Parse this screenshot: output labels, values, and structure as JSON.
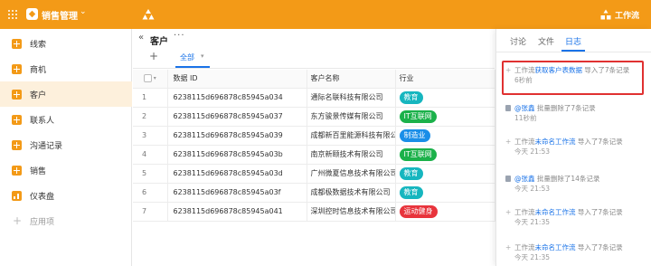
{
  "topbar": {
    "app_title": "销售管理",
    "caret": "⌄",
    "workflow_label": "工作流",
    "bg_color": "#f39a17"
  },
  "sidebar": {
    "items": [
      {
        "label": "线索",
        "icon": "plus-square-icon",
        "active": false
      },
      {
        "label": "商机",
        "icon": "plus-square-icon",
        "active": false
      },
      {
        "label": "客户",
        "icon": "plus-square-icon",
        "active": true
      },
      {
        "label": "联系人",
        "icon": "plus-square-icon",
        "active": false
      },
      {
        "label": "沟通记录",
        "icon": "plus-square-icon",
        "active": false
      },
      {
        "label": "销售",
        "icon": "plus-square-icon",
        "active": false
      },
      {
        "label": "仪表盘",
        "icon": "dashboard-icon",
        "active": false
      }
    ],
    "add_app_label": "应用项"
  },
  "main": {
    "back": "«",
    "title": "客户",
    "more": "···",
    "add_view": "+",
    "tab_all": "全部",
    "tab_caret": "▾",
    "columns": [
      "",
      "数据 ID",
      "客户名称",
      "行业"
    ],
    "rows": [
      {
        "idx": "1",
        "id": "6238115d696878c85945a034",
        "name": "通际名联科技有限公司",
        "industry": "教育",
        "color": "#16b6bf"
      },
      {
        "idx": "2",
        "id": "6238115d696878c85945a037",
        "name": "东方骏景传媒有限公司",
        "industry": "IT互联网",
        "color": "#1bb14a"
      },
      {
        "idx": "3",
        "id": "6238115d696878c85945a039",
        "name": "成都新百里能源科技有限公司",
        "industry": "制造业",
        "color": "#1a8ee8"
      },
      {
        "idx": "4",
        "id": "6238115d696878c85945a03b",
        "name": "南京新颐技术有限公司",
        "industry": "IT互联网",
        "color": "#1bb14a"
      },
      {
        "idx": "5",
        "id": "6238115d696878c85945a03d",
        "name": "广州微夏信息技术有限公司",
        "industry": "教育",
        "color": "#16b6bf"
      },
      {
        "idx": "6",
        "id": "6238115d696878c85945a03f",
        "name": "成都极数据技术有限公司",
        "industry": "教育",
        "color": "#16b6bf"
      },
      {
        "idx": "7",
        "id": "6238115d696878c85945a041",
        "name": "深圳控时信息技术有限公司",
        "industry": "运动健身",
        "color": "#e8343c"
      }
    ]
  },
  "panel": {
    "tabs": [
      "讨论",
      "文件",
      "日志"
    ],
    "logs": [
      {
        "icon": "plus",
        "prefix": "工作流",
        "link": "获取客户表数据",
        "suffix": " 导入了7条记录",
        "time": "6秒前"
      },
      {
        "icon": "trash",
        "prefix": "",
        "link": "@张鑫",
        "suffix": " 批量删除了7条记录",
        "time": "11秒前"
      },
      {
        "icon": "plus",
        "prefix": "工作流",
        "link": "未命名工作流",
        "suffix": " 导入了7条记录",
        "time": "今天 21:53"
      },
      {
        "icon": "trash",
        "prefix": "",
        "link": "@张鑫",
        "suffix": " 批量删除了14条记录",
        "time": "今天 21:53"
      },
      {
        "icon": "plus",
        "prefix": "工作流",
        "link": "未命名工作流",
        "suffix": " 导入了7条记录",
        "time": "今天 21:35"
      },
      {
        "icon": "plus",
        "prefix": "工作流",
        "link": "未命名工作流",
        "suffix": " 导入了7条记录",
        "time": "今天 21:35"
      }
    ]
  }
}
